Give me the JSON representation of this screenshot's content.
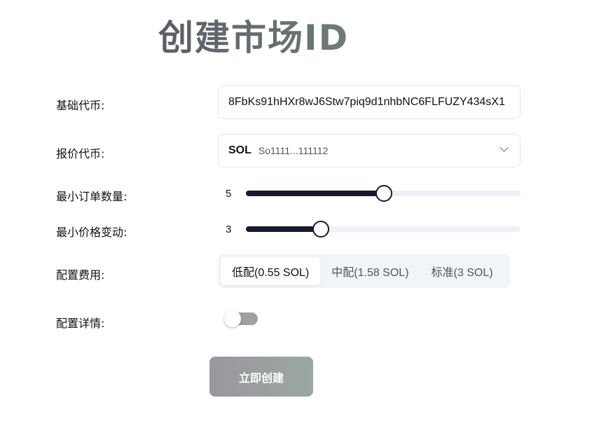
{
  "title": "创建市场ID",
  "form": {
    "base_token": {
      "label": "基础代币:",
      "value": "8FbKs91hHXr8wJ6Stw7piq9d1nhbNC6FLFUZY434sX1"
    },
    "quote_token": {
      "label": "报价代币:",
      "symbol": "SOL",
      "address": "So1111...111112"
    },
    "min_order": {
      "label": "最小订单数量:",
      "value": "5",
      "percent": 50
    },
    "min_tick": {
      "label": "最小价格变动:",
      "value": "3",
      "percent": 27
    },
    "fee": {
      "label": "配置费用:",
      "options": [
        "低配(0.55 SOL)",
        "中配(1.58 SOL)",
        "标准(3 SOL)"
      ],
      "selected": 0
    },
    "details": {
      "label": "配置详情:",
      "enabled": false
    },
    "submit_label": "立即创建"
  }
}
